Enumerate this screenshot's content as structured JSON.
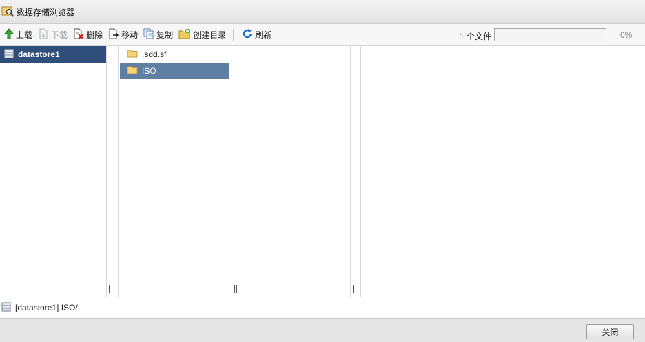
{
  "window": {
    "title": "数据存储浏览器"
  },
  "toolbar": {
    "upload": "上载",
    "download": "下载",
    "delete": "删除",
    "move": "移动",
    "copy": "复制",
    "create_dir": "创建目录",
    "refresh": "刷新",
    "files_count": "1 个文件",
    "progress_percent": 0,
    "progress_label": "0%"
  },
  "datastores": [
    {
      "name": "datastore1",
      "selected": true
    }
  ],
  "folders": [
    {
      "name": ".sdd.sf",
      "selected": false
    },
    {
      "name": "ISO",
      "selected": true
    }
  ],
  "path": "[datastore1] ISO/",
  "footer": {
    "close_label": "关闭"
  },
  "colors": {
    "selected_dark": "#2f4f7a",
    "selected_light": "#5f7ea3",
    "annotation_red": "#e0161b"
  }
}
